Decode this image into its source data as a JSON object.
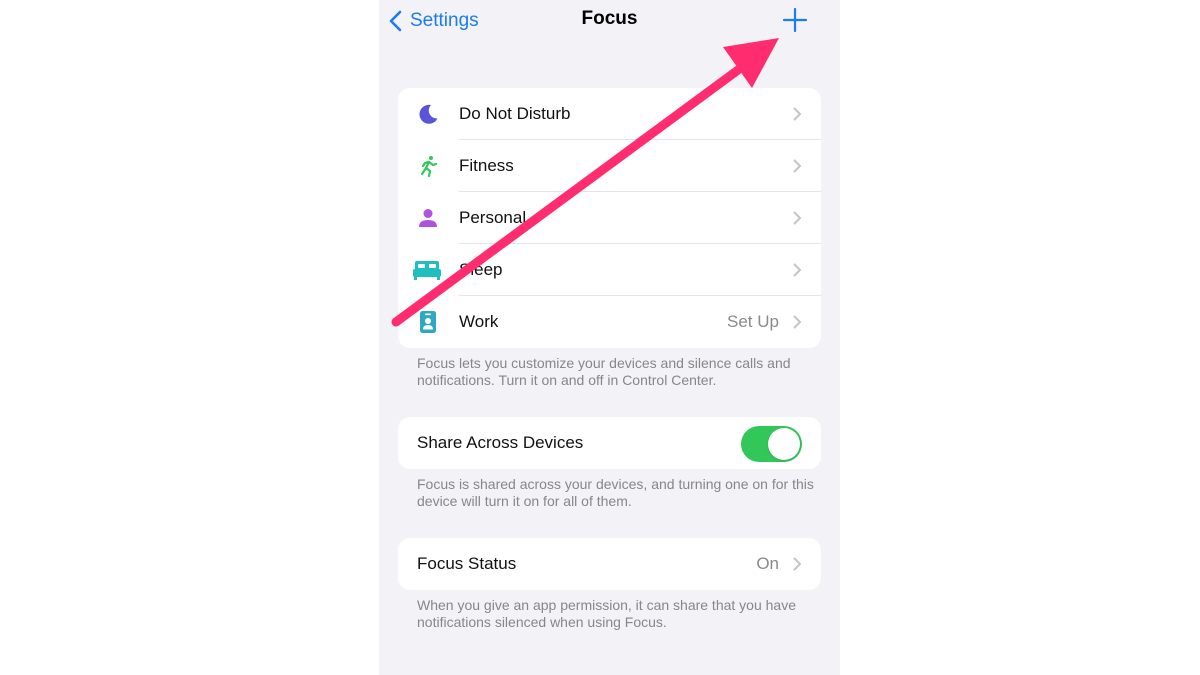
{
  "nav": {
    "back_label": "Settings",
    "title": "Focus",
    "add_icon": "plus-icon"
  },
  "focus_modes": [
    {
      "label": "Do Not Disturb",
      "icon": "moon-icon",
      "color": "#5856d6",
      "value": ""
    },
    {
      "label": "Fitness",
      "icon": "running-figure-icon",
      "color": "#34c759",
      "value": ""
    },
    {
      "label": "Personal",
      "icon": "person-icon",
      "color": "#af52de",
      "value": ""
    },
    {
      "label": "Sleep",
      "icon": "bed-icon",
      "color": "#1fbfbf",
      "value": ""
    },
    {
      "label": "Work",
      "icon": "id-badge-icon",
      "color": "#2fa8c6",
      "value": "Set Up"
    }
  ],
  "focus_footer": "Focus lets you customize your devices and silence calls and notifications. Turn it on and off in Control Center.",
  "share": {
    "label": "Share Across Devices",
    "enabled": true,
    "footer": "Focus is shared across your devices, and turning one on for this device will turn it on for all of them."
  },
  "status": {
    "label": "Focus Status",
    "value": "On",
    "footer": "When you give an app permission, it can share that you have notifications silenced when using Focus."
  },
  "colors": {
    "accent": "#1a7cf5",
    "toggle_on": "#33c759",
    "annotation_arrow": "#ff2d6f",
    "background": "#f2f2f7"
  },
  "annotation": {
    "type": "arrow",
    "points_to": "add-focus-button"
  }
}
